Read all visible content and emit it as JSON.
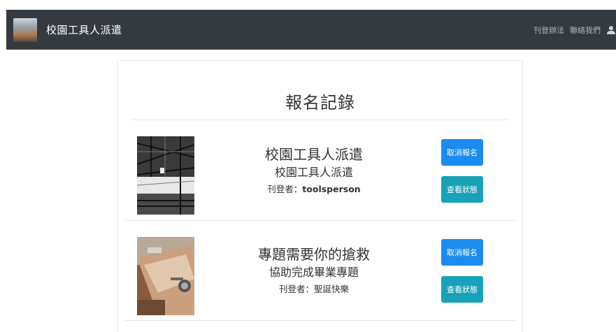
{
  "navbar": {
    "brand_text": "校園工具人派遣",
    "links": [
      "刊登辦法",
      "聯絡我們"
    ]
  },
  "page_title": "報名記錄",
  "items": [
    {
      "title": "校園工具人派遣",
      "subtitle": "校園工具人派遣",
      "poster_label": "刊登者：",
      "poster_name": "toolsperson",
      "cancel_label": "取消報名",
      "status_label": "查看狀態"
    },
    {
      "title": "專題需要你的搶救",
      "subtitle": "協助完成畢業專題",
      "poster_label": "刊登者：",
      "poster_name": "聖誕快樂",
      "cancel_label": "取消報名",
      "status_label": "查看狀態"
    }
  ],
  "colors": {
    "navbar_bg": "#343a40",
    "cancel_button": "#1a8cf0",
    "status_button": "#17a2b8"
  }
}
